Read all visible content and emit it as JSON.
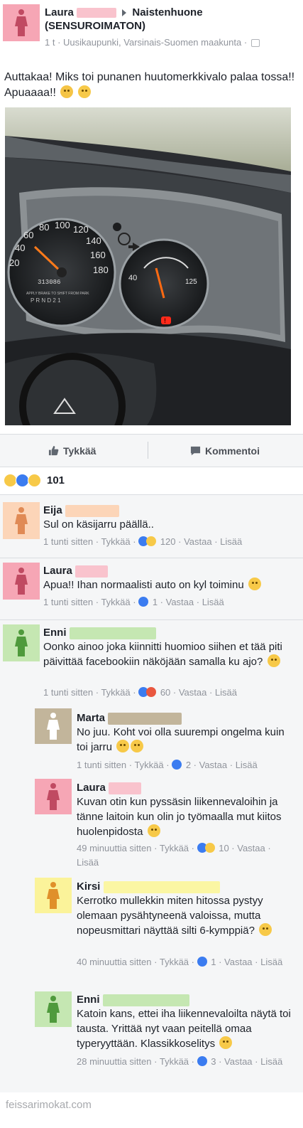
{
  "post": {
    "author": "Laura",
    "group_line1": "Naistenhuone",
    "group_line2": "(SENSUROIMATON)",
    "meta": "1 t · Uusikaupunki, Varsinais-Suomen maakunta ·",
    "text": "Auttakaa! Miks toi punanen huutomerkkivalo palaa tossa!! Apuaaaa!!",
    "author_color": "#f6a6b5"
  },
  "photo": {
    "speedo_ticks": [
      "20",
      "40",
      "60",
      "80",
      "100",
      "120",
      "140",
      "160",
      "180"
    ],
    "temp_ticks": [
      "40",
      "125"
    ],
    "odometer": "313086",
    "gear": "P R N D 2 1",
    "warning_symbol": "!",
    "notice": "APPLY BRAKE TO SHIFT FROM PARK"
  },
  "actions": {
    "like_label": "Tykkää",
    "comment_label": "Kommentoi"
  },
  "reactions": {
    "count": "101"
  },
  "comments": [
    {
      "name": "Eija",
      "text": "Sul on käsijarru päällä..",
      "time": "1 tunti sitten",
      "like": "Tykkää",
      "count": "120",
      "reply": "Vastaa",
      "more": "Lisää",
      "avatar_color": "#fcd5b8",
      "redact_color": "#fcd5b8"
    },
    {
      "name": "Laura",
      "text": "Apua!! Ihan normaalisti auto on kyl toiminu",
      "time": "1 tunti sitten",
      "like": "Tykkää",
      "count": "1",
      "reply": "Vastaa",
      "more": "Lisää",
      "avatar_color": "#f6a6b5",
      "redact_color": "#f6a6b5"
    },
    {
      "name": "Enni",
      "text": "Oonko ainoo joka kiinnitti huomioo siihen et tää piti päivittää facebookiin näköjään samalla ku ajo?",
      "time": "1 tunti sitten",
      "like": "Tykkää",
      "count": "60",
      "reply": "Vastaa",
      "more": "Lisää",
      "avatar_color": "#c5e7b2",
      "redact_color": "#c5e7b2"
    },
    {
      "name": "Marta",
      "text": "No juu. Koht voi olla suurempi ongelma kuin toi jarru",
      "time": "1 tunti sitten",
      "like": "Tykkää",
      "count": "2",
      "reply": "Vastaa",
      "more": "Lisää",
      "avatar_color": "#c2b59b",
      "redact_color": "#c2b59b"
    },
    {
      "name": "Laura",
      "text": "Kuvan otin kun pyssäsin liikennevaloihin ja tänne laitoin kun olin jo työmaalla mut kiitos huolenpidosta",
      "time": "49 minuuttia sitten",
      "like": "Tykkää",
      "count": "10",
      "reply": "Vastaa",
      "more": "Lisää",
      "avatar_color": "#f6a6b5",
      "redact_color": "#f6a6b5"
    },
    {
      "name": "Kirsi",
      "text": "Kerrotko mullekkin miten hitossa pystyy olemaan pysähtyneenä valoissa, mutta nopeusmittari näyttää silti 6-kymppiä?",
      "time": "40 minuuttia sitten",
      "like": "Tykkää",
      "count": "1",
      "reply": "Vastaa",
      "more": "Lisää",
      "avatar_color": "#fbf39a",
      "redact_color": "#fbf6a3"
    },
    {
      "name": "Enni",
      "text": "Katoin kans, ettei iha liikennevaloilta näytä toi tausta. Yrittää nyt vaan peitellä omaa typeryyttään. Klassikkoselitys",
      "time": "28 minuuttia sitten",
      "like": "Tykkää",
      "count": "3",
      "reply": "Vastaa",
      "more": "Lisää",
      "avatar_color": "#c5e7b2",
      "redact_color": "#c5e7b2"
    }
  ],
  "watermark": "feissarimokat.com"
}
